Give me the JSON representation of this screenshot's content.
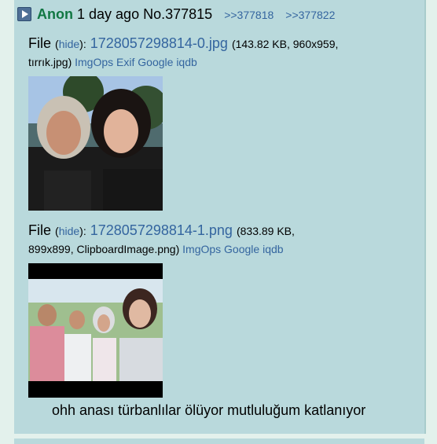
{
  "post": {
    "name": "Anon",
    "time": "1 day ago",
    "number": "No.377815",
    "backlinks": [
      ">>377818",
      ">>377822"
    ]
  },
  "files": [
    {
      "label": "File",
      "hide": "hide",
      "filename": "1728057298814-0.jpg",
      "info_line1": "(143.82 KB, 960x959,",
      "info_line2": "tırrık.jpg)",
      "tools": [
        "ImgOps",
        "Exif",
        "Google",
        "iqdb"
      ]
    },
    {
      "label": "File",
      "hide": "hide",
      "filename": "1728057298814-1.png",
      "info_line1": "(833.89 KB,",
      "info_line2": "899x899, ClipboardImage.png)",
      "tools": [
        "ImgOps",
        "Google",
        "iqdb"
      ]
    }
  ],
  "message": "ohh anası türbanlılar ölüyor mutluluğum katlanıyor"
}
